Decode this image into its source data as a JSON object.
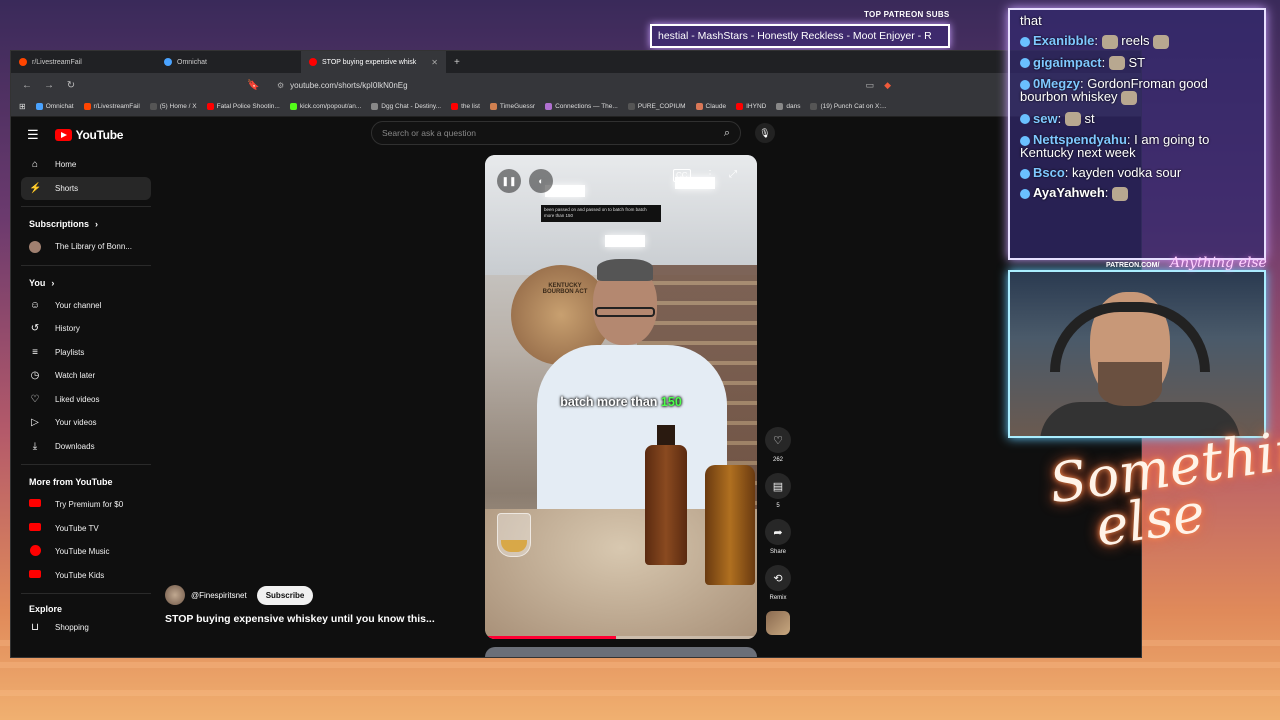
{
  "browser": {
    "tabs": [
      {
        "label": "r/LivestreamFail",
        "color": "#ff4500",
        "active": false
      },
      {
        "label": "Omnichat",
        "color": "#4aa3ff",
        "active": false
      },
      {
        "label": "STOP buying expensive whisk",
        "color": "#ff0000",
        "active": true
      }
    ],
    "url": "youtube.com/shorts/kpI0lkN0nEg",
    "bookmarks": [
      {
        "label": "Omnichat",
        "color": "#4aa3ff"
      },
      {
        "label": "r/LivestreamFail",
        "color": "#ff4500"
      },
      {
        "label": "(5) Home / X",
        "color": "#000000"
      },
      {
        "label": "Fatal Police Shootin...",
        "color": "#ff0000"
      },
      {
        "label": "kick.com/popout/an...",
        "color": "#53fc18"
      },
      {
        "label": "Dgg Chat - Destiny...",
        "color": "#888888"
      },
      {
        "label": "the list",
        "color": "#ff0000"
      },
      {
        "label": "TimeGuessr",
        "color": "#d08050"
      },
      {
        "label": "Connections — The...",
        "color": "#b070d0"
      },
      {
        "label": "PURE_COPIUM",
        "color": "#000000"
      },
      {
        "label": "Claude",
        "color": "#d97757"
      },
      {
        "label": "IHYND",
        "color": "#ff0000"
      },
      {
        "label": "dans",
        "color": "#888888"
      },
      {
        "label": "(19) Punch Cat on X:...",
        "color": "#000000"
      }
    ]
  },
  "youtube": {
    "logo_text": "YouTube",
    "search_placeholder": "Search or ask a question",
    "sidebar": {
      "main": [
        {
          "label": "Home",
          "icon": "home-icon",
          "glyph": "⌂"
        },
        {
          "label": "Shorts",
          "icon": "shorts-icon",
          "glyph": "⚡"
        }
      ],
      "subscriptions_title": "Subscriptions",
      "subscriptions": [
        {
          "label": "The Library of Bonn..."
        }
      ],
      "you_title": "You",
      "you": [
        {
          "label": "Your channel",
          "icon": "channel-icon",
          "glyph": "☺"
        },
        {
          "label": "History",
          "icon": "history-icon",
          "glyph": "↺"
        },
        {
          "label": "Playlists",
          "icon": "playlists-icon",
          "glyph": "≡"
        },
        {
          "label": "Watch later",
          "icon": "clock-icon",
          "glyph": "◷"
        },
        {
          "label": "Liked videos",
          "icon": "thumbs-up-icon",
          "glyph": "👍"
        },
        {
          "label": "Your videos",
          "icon": "video-icon",
          "glyph": "▶"
        },
        {
          "label": "Downloads",
          "icon": "download-icon",
          "glyph": "⤓"
        }
      ],
      "more_title": "More from YouTube",
      "more": [
        {
          "label": "Try Premium for $0"
        },
        {
          "label": "YouTube TV"
        },
        {
          "label": "YouTube Music"
        },
        {
          "label": "YouTube Kids"
        }
      ],
      "explore_title": "Explore",
      "explore": [
        {
          "label": "Shopping",
          "icon": "shopping-icon",
          "glyph": "🛍"
        }
      ]
    },
    "short": {
      "small_caption": "been passed on and passed on to batch from batch more than 150",
      "caption_prefix": "batch more than ",
      "caption_highlight": "150",
      "barrel_text": "KENTUCKY BOURBON ACT",
      "progress": 0.48,
      "likes": "262",
      "comments": "5",
      "share_label": "Share",
      "remix_label": "Remix",
      "channel": "@Finespiritsnet",
      "subscribe_label": "Subscribe",
      "title": "STOP buying expensive whiskey until you know this..."
    }
  },
  "overlay": {
    "patreon_label": "TOP PATREON SUBS",
    "ticker": "hestial - MashStars - Honestly Reckless - Moot Enjoyer - R",
    "chat": [
      {
        "user": "",
        "text": "that",
        "color": "#ffffff"
      },
      {
        "user": "Exanibble",
        "text": "reels",
        "color": "#7fc8ff"
      },
      {
        "user": "gigaimpact",
        "text": "ST",
        "color": "#7fc8ff"
      },
      {
        "user": "0Megzy",
        "text": "GordonFroman good bourbon whiskey",
        "color": "#7fc8ff"
      },
      {
        "user": "sew",
        "text": "st",
        "color": "#7fc8ff"
      },
      {
        "user": "Nettspendyahu",
        "text": "I am going to Kentucky next week",
        "color": "#7fc8ff"
      },
      {
        "user": "Bsco",
        "text": "kayden vodka sour",
        "color": "#7fc8ff"
      },
      {
        "user": "AyaYahweh",
        "text": "",
        "color": "#ffffff"
      }
    ],
    "patreon_url": "PATREON.COM/",
    "logo": "Anything else",
    "neon_line1": "Something",
    "neon_line2": "else"
  }
}
